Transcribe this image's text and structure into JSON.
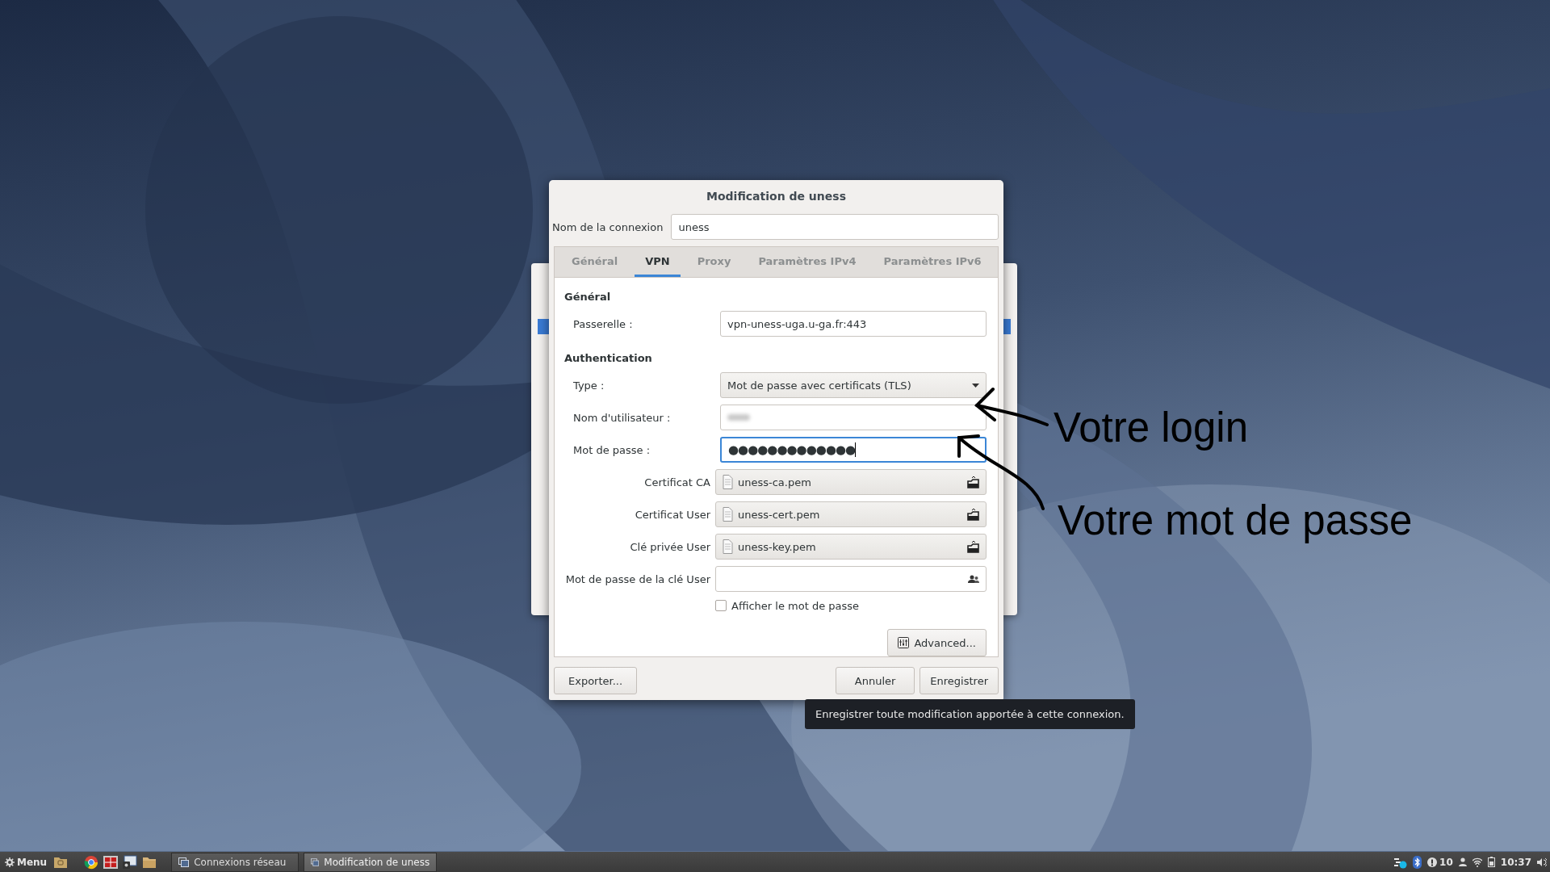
{
  "dialog": {
    "title": "Modification de uness",
    "connection_name": {
      "label": "Nom de la connexion",
      "value": "uness"
    },
    "tabs": [
      {
        "label": "Général",
        "selected": false
      },
      {
        "label": "VPN",
        "selected": true
      },
      {
        "label": "Proxy",
        "selected": false
      },
      {
        "label": "Paramètres IPv4",
        "selected": false
      },
      {
        "label": "Paramètres IPv6",
        "selected": false
      }
    ],
    "sections": [
      {
        "heading": "Général",
        "rows": [
          {
            "kind": "text",
            "label": "Passerelle :",
            "value": "vpn-uness-uga.u-ga.fr:443"
          }
        ]
      },
      {
        "heading": "Authentication",
        "rows": [
          {
            "kind": "select",
            "label": "Type :",
            "value": "Mot de passe avec certificats (TLS)"
          },
          {
            "kind": "text",
            "label": "Nom d'utilisateur :",
            "redacted": true
          },
          {
            "kind": "password",
            "label": "Mot de passe :",
            "value": "●●●●●●●●●●●●●",
            "focused": true
          },
          {
            "kind": "file",
            "label": "Certificat CA",
            "value": "uness-ca.pem"
          },
          {
            "kind": "file",
            "label": "Certificat User",
            "value": "uness-cert.pem"
          },
          {
            "kind": "file",
            "label": "Clé privée User",
            "value": "uness-key.pem"
          },
          {
            "kind": "secret",
            "label": "Mot de passe de la clé User"
          },
          {
            "kind": "checkbox",
            "label": "Afficher le mot de passe",
            "checked": false
          }
        ]
      }
    ],
    "advanced_button": "Advanced...",
    "buttons": {
      "export": "Exporter...",
      "cancel": "Annuler",
      "save": "Enregistrer"
    }
  },
  "tooltip": "Enregistrer toute modification apportée à cette connexion.",
  "annotations": [
    {
      "text": "Votre login"
    },
    {
      "text": "Votre mot de passe"
    }
  ],
  "taskbar": {
    "menu": "Menu",
    "windows": [
      {
        "label": "Connexions réseau",
        "selected": false
      },
      {
        "label": "Modification de uness",
        "selected": true
      }
    ],
    "notifications": "10",
    "clock": "10:37"
  }
}
